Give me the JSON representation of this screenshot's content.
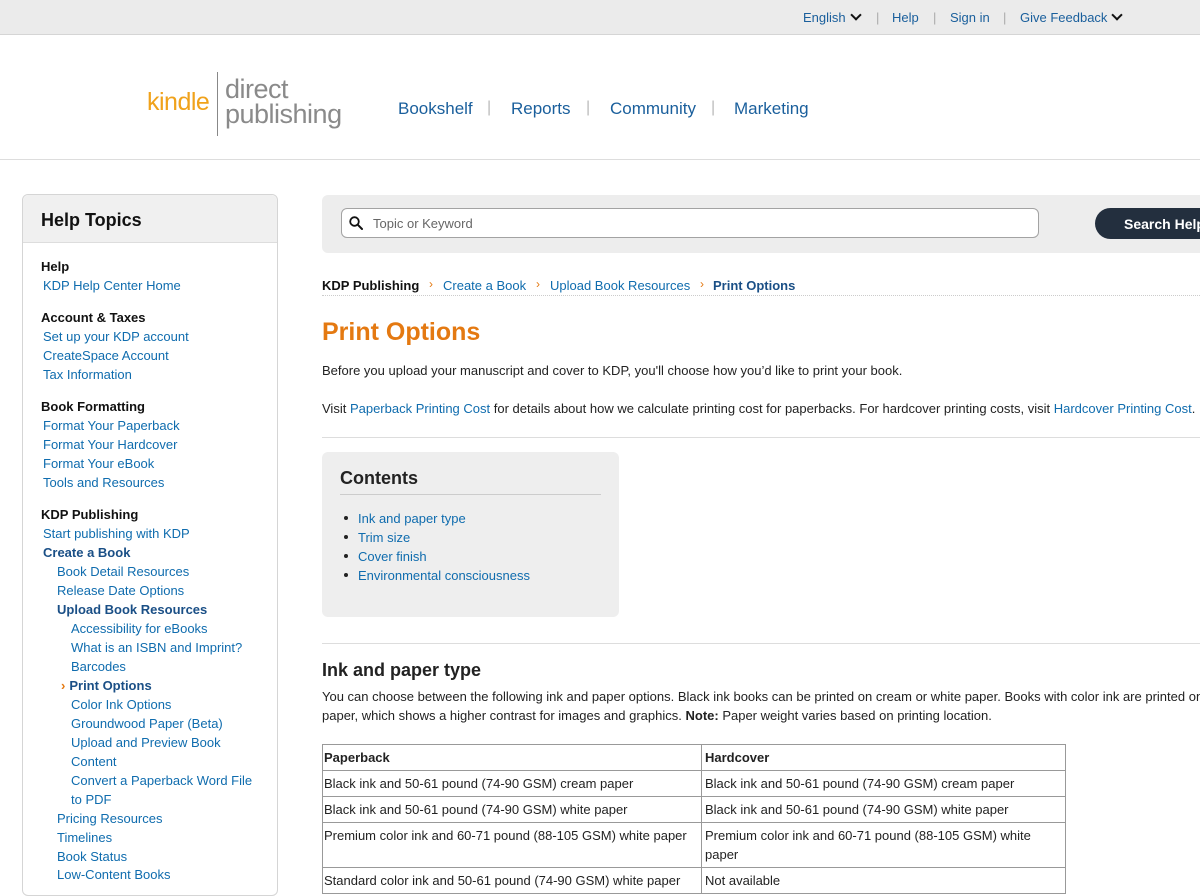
{
  "topbar": {
    "language": "English",
    "help": "Help",
    "sign_in": "Sign in",
    "feedback": "Give Feedback"
  },
  "logo": {
    "kindle": "kindle",
    "direct": "direct",
    "publishing": "publishing",
    "brand_color": "#f0a21b"
  },
  "nav": [
    "Bookshelf",
    "Reports",
    "Community",
    "Marketing"
  ],
  "sidebar": {
    "title": "Help Topics",
    "groups": {
      "help": "Help",
      "help_home": "KDP Help Center Home",
      "account": "Account & Taxes",
      "setup": "Set up your KDP account",
      "createspace": "CreateSpace Account",
      "tax": "Tax Information",
      "formatting": "Book Formatting",
      "fmt_paperback": "Format Your Paperback",
      "fmt_hardcover": "Format Your Hardcover",
      "fmt_ebook": "Format Your eBook",
      "tools": "Tools and Resources",
      "publishing": "KDP Publishing",
      "start": "Start publishing with KDP",
      "create": "Create a Book",
      "detail": "Book Detail Resources",
      "release": "Release Date Options",
      "upload": "Upload Book Resources",
      "access": "Accessibility for eBooks",
      "isbn": "What is an ISBN and Imprint?",
      "barcodes": "Barcodes",
      "print": "Print Options",
      "color_ink": "Color Ink Options",
      "groundwood": "Groundwood Paper (Beta)",
      "upload_preview_1": "Upload and Preview Book",
      "upload_preview_2": "Content",
      "convert_1": "Convert a Paperback Word File",
      "convert_2": "to PDF",
      "pricing": "Pricing Resources",
      "timelines": "Timelines",
      "status": "Book Status",
      "low_content": "Low-Content Books"
    }
  },
  "search": {
    "placeholder": "Topic or Keyword",
    "button": "Search Help"
  },
  "breadcrumb": [
    "KDP Publishing",
    "Create a Book",
    "Upload Book Resources",
    "Print Options"
  ],
  "main": {
    "title": "Print Options",
    "intro": "Before you upload your manuscript and cover to KDP, you'll choose how you’d like to print your book.",
    "visit_pre": "Visit ",
    "visit_link1": "Paperback Printing Cost",
    "visit_mid": " for details about how we calculate printing cost for paperbacks. For hardcover printing costs, visit ",
    "visit_link2": "Hardcover Printing Cost",
    "visit_post": ".",
    "contents_title": "Contents",
    "contents": [
      "Ink and paper type",
      "Trim size",
      "Cover finish",
      "Environmental consciousness"
    ],
    "section_title": "Ink and paper type",
    "section_line1": "You can choose between the following ink and paper options. Black ink books can be printed on cream or white paper. Books with color ink are printed on white",
    "section_line2_pre": "paper, which shows a higher contrast for images and graphics. ",
    "section_note_label": "Note:",
    "section_line2_post": " Paper weight varies based on printing location."
  },
  "table": {
    "headers": [
      "Paperback",
      "Hardcover"
    ],
    "rows": [
      [
        "Black ink and 50-61 pound (74-90 GSM) cream paper",
        "Black ink and 50-61 pound (74-90 GSM) cream paper"
      ],
      [
        "Black ink and 50-61 pound (74-90 GSM) white paper",
        "Black ink and 50-61 pound (74-90 GSM) white paper"
      ],
      [
        "Premium color ink and 60-71 pound (88-105 GSM) white paper",
        "Premium color ink and 60-71 pound (88-105 GSM) white paper"
      ],
      [
        "Standard color ink and 50-61 pound (74-90 GSM) white paper",
        "Not available"
      ]
    ]
  },
  "colors": {
    "link": "#0f6cae",
    "accent": "#e47911",
    "button_bg": "#232f3e"
  }
}
